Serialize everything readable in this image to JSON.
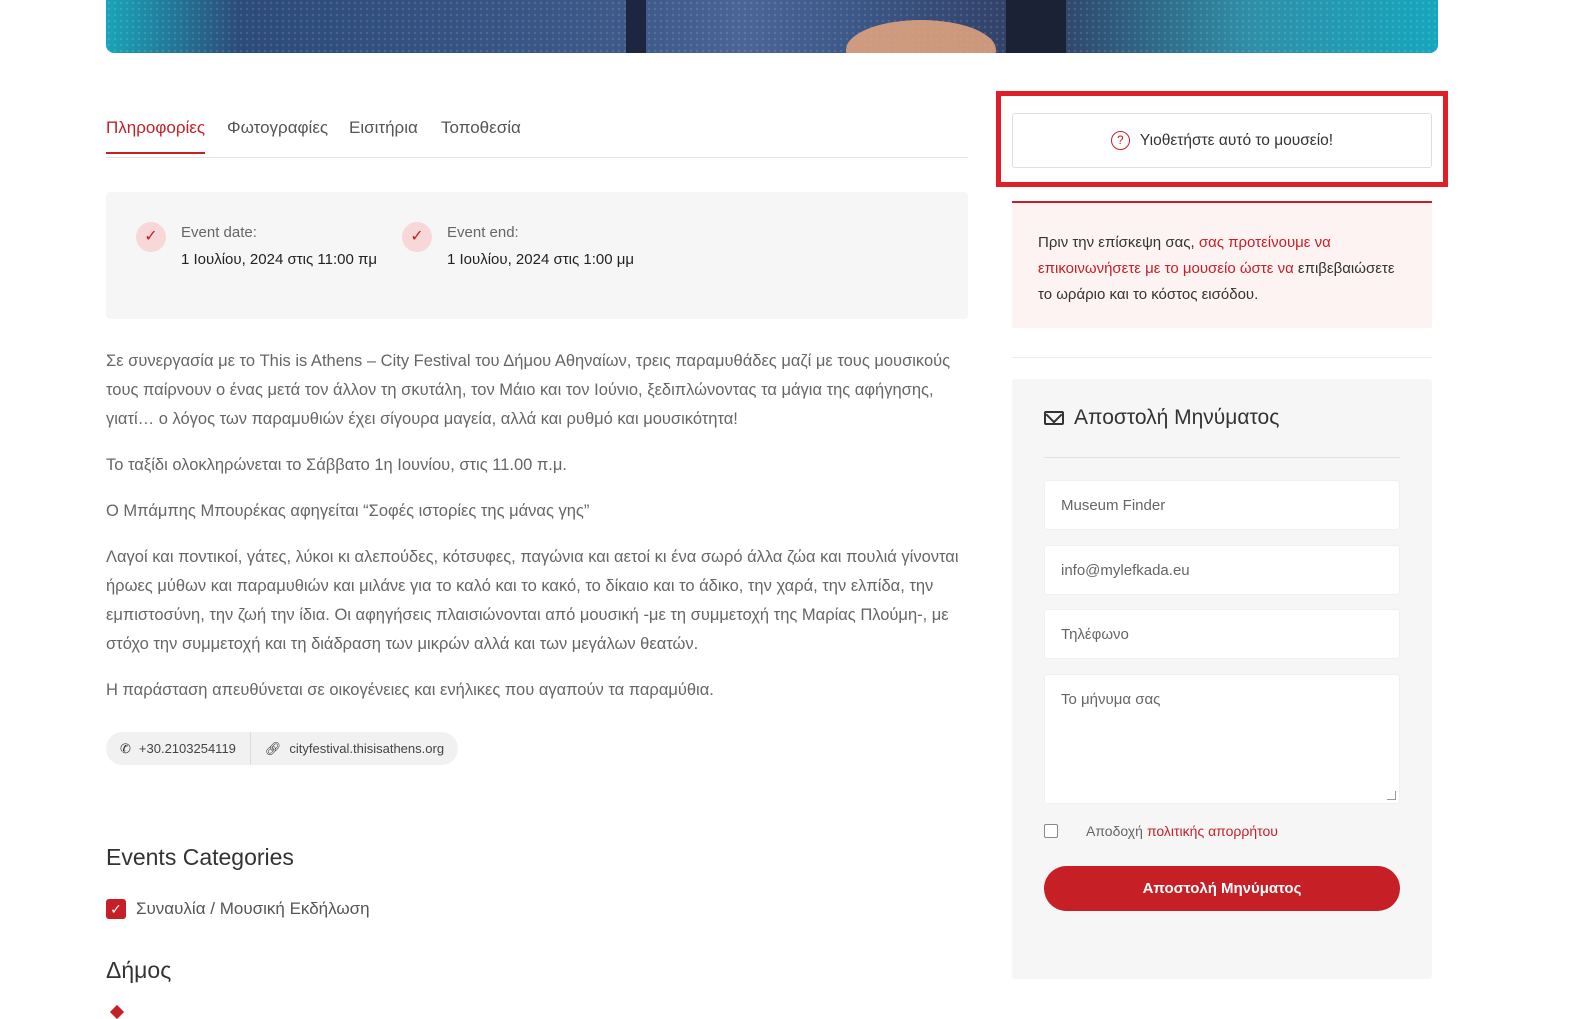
{
  "tabs": [
    {
      "label": "Πληροφορίες"
    },
    {
      "label": "Φωτογραφίες"
    },
    {
      "label": "Εισιτήρια"
    },
    {
      "label": "Τοποθεσία"
    }
  ],
  "event": {
    "start_label": "Event date:",
    "start_value": "1 Ιουλίου, 2024 στις 11:00 πμ",
    "end_label": "Event end:",
    "end_value": "1 Ιουλίου, 2024 στις 1:00 μμ"
  },
  "description": [
    "Σε συνεργασία με το This is Athens – City Festival του Δήμου Αθηναίων, τρεις παραμυθάδες μαζί με τους μουσικούς τους παίρνουν ο ένας μετά τον άλλον τη σκυτάλη, τον Μάιο και τον Ιούνιο, ξεδιπλώνοντας τα μάγια της αφήγησης, γιατί… ο λόγος των παραμυθιών έχει σίγουρα μαγεία, αλλά και ρυθμό και μουσικότητα!",
    "Το ταξίδι ολοκληρώνεται το Σάββατο 1η Ιουνίου, στις 11.00 π.μ.",
    "Ο Μπάμπης Μπουρέκας αφηγείται “Σοφές ιστορίες της μάνας γης”",
    "Λαγοί και ποντικοί, γάτες, λύκοι κι αλεπούδες, κότσυφες, παγώνια και αετοί κι ένα σωρό άλλα ζώα και πουλιά γίνονται ήρωες μύθων και παραμυθιών και μιλάνε για το καλό και το κακό, το δίκαιο και το άδικο, την χαρά, την ελπίδα, την εμπιστοσύνη, την ζωή την ίδια. Οι αφηγήσεις πλαισιώνονται από μουσική -με τη συμμετοχή της Μαρίας Πλούμη-, με στόχο την συμμετοχή και τη διάδραση των μικρών αλλά και των μεγάλων θεατών.",
    "Η παράσταση απευθύνεται σε οικογένειες και ενήλικες που αγαπούν τα παραμύθια."
  ],
  "contacts": {
    "phone": "+30.2103254119",
    "website": "cityfestival.thisisathens.org"
  },
  "categories": {
    "title": "Events Categories",
    "item": "Συναυλία / Μουσική Εκδήλωση"
  },
  "dimos": {
    "title": "Δήμος"
  },
  "sidebar": {
    "adopt_label": "Υιοθετήστε αυτό το μουσείο!",
    "notice_part1": "Πριν την επίσκεψη σας, ",
    "notice_part2": "σας προτείνουμε να επικοινωνήσετε με το μουσείο ώστε να",
    "notice_part3": " επιβεβαιώσετε το ωράριο και το κόστος εισόδου.",
    "form_title": "Αποστολή Μηνύματος",
    "name_placeholder": "Museum Finder",
    "email_placeholder": "info@mylefkada.eu",
    "phone_placeholder": "Τηλέφωνο",
    "message_placeholder": "Το μήνυμα σας",
    "consent_text": "Αποδοχή",
    "consent_link": "πολιτικής απορρήτου",
    "submit_label": "Αποστολή Μηνύματος"
  },
  "colors": {
    "accent": "#c62026",
    "highlight": "#e01e29"
  }
}
